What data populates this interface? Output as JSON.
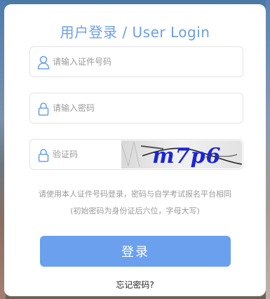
{
  "header": {
    "title": "用户登录 / User Login"
  },
  "form": {
    "id_number": {
      "value": "",
      "placeholder": "请输入证件号码",
      "icon": "user-icon"
    },
    "password": {
      "value": "",
      "placeholder": "请输入密码",
      "icon": "lock-icon"
    },
    "captcha": {
      "value": "",
      "placeholder": "验证码",
      "icon": "lock-icon",
      "image_text": "m7p6"
    }
  },
  "hints": {
    "line1": "请使用本人证件号码登录，密码与自学考试报名平台相同",
    "line2": "(初始密码为身份证后六位，字母大写)"
  },
  "actions": {
    "login_label": "登录",
    "forgot_label": "忘记密码?"
  },
  "colors": {
    "accent": "#6aa0ee",
    "title": "#6b9ee8",
    "captcha_text": "#1b24d8"
  }
}
